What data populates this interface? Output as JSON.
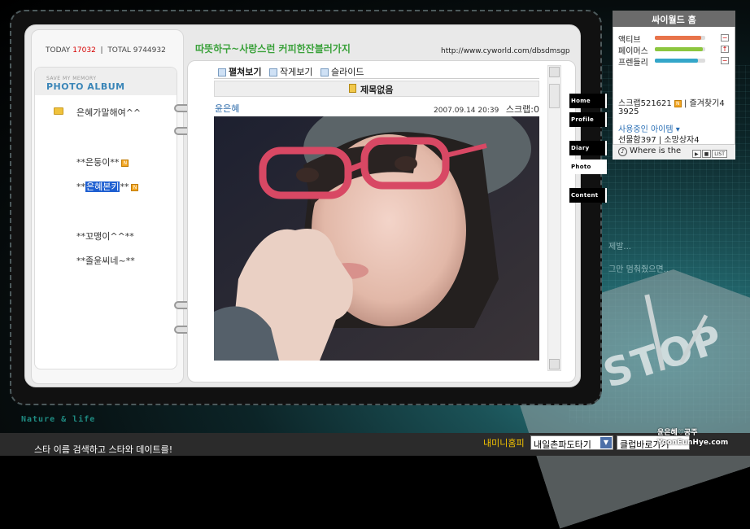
{
  "header": {
    "today_label": "TODAY",
    "today_value": "17032",
    "total_label": "TOTAL",
    "total_value": "9744932",
    "title": "따뜻하구~사랑스런 커피한잔블러가지",
    "url": "http://www.cyworld.com/dbsdmsgp"
  },
  "album": {
    "save_label": "SAVE MY MEMORY",
    "title": "PHOTO ALBUM",
    "folder": "은혜가말해여^^",
    "items": [
      {
        "label": "**은둥이**",
        "new": "N"
      },
      {
        "label_pre": "**",
        "label_hl": "은혜본키",
        "label_post": "**",
        "new": "N"
      },
      {
        "label": "**꼬맹이^^**"
      },
      {
        "label": "**졸윤씨네~**"
      }
    ]
  },
  "view_tabs": [
    "펼쳐보기",
    "작게보기",
    "슬라이드"
  ],
  "post": {
    "title": "제목없음",
    "author": "윤은혜",
    "date": "2007.09.14 20:39",
    "scrap": "스크랩:0"
  },
  "nav": [
    "Home",
    "Profile",
    "Diary",
    "Photo",
    "Content"
  ],
  "nav_active": "Photo",
  "decor": {
    "nature": "Nature & life",
    "line1": "제발...",
    "line2": "그만 멈춰줬으면..",
    "stop": "STOP"
  },
  "cyworld": {
    "title": "싸이월드 홈",
    "stats": [
      {
        "label": "액티브",
        "fill": 0.92,
        "color": "#e8734a",
        "btn": "−"
      },
      {
        "label": "페이머스",
        "fill": 0.95,
        "color": "#8cc63f",
        "btn": "↑"
      },
      {
        "label": "프렌들리",
        "fill": 0.85,
        "color": "#33a6c9",
        "btn": "−"
      }
    ],
    "scrap": "스크랩521621",
    "fav": "즐겨찾기4",
    "fav_count": "3925",
    "item_link": "사용중인 아이템",
    "gift": "선물함397",
    "wish": "소망상자4",
    "where": "Where is the",
    "list_btn": "LIST"
  },
  "bottom": {
    "search_text": "스타 이름 검색하고 스타와 데이트를!",
    "mini_label": "내미니홈피",
    "select1": "내일촌파도타기",
    "select2": "클럽바로가기",
    "watermark": "윤은혜♡공주 YoonEunHye.com"
  },
  "colors": {
    "today": "#d60000",
    "album_title": "#3b86b8",
    "title_green": "#3aa13a",
    "mini_yellow": "#f5c500"
  }
}
